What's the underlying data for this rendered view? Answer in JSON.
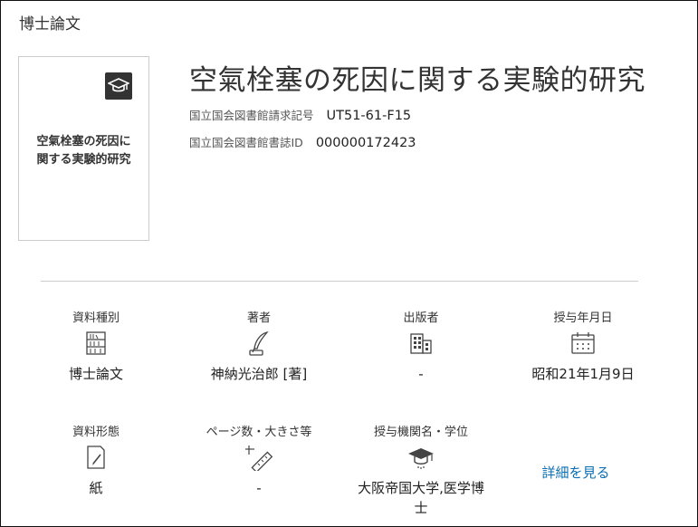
{
  "section_label": "博士論文",
  "thumbnail": {
    "icon": "graduation-cap-icon",
    "title_line1": "空氣栓塞の死因に",
    "title_line2": "関する実験的研究"
  },
  "title": "空氣栓塞の死因に関する実験的研究",
  "meta": {
    "call_number_label": "国立国会図書館請求記号",
    "call_number": "UT51-61-F15",
    "biblio_id_label": "国立国会図書館書誌ID",
    "biblio_id": "000000172423"
  },
  "details": {
    "material_type": {
      "label": "資料種別",
      "icon": "bookshelf-icon",
      "value": "博士論文"
    },
    "author": {
      "label": "著者",
      "icon": "quill-pen-icon",
      "value": "神納光治郎 [著]"
    },
    "publisher": {
      "label": "出版者",
      "icon": "building-icon",
      "value": "-"
    },
    "conferral_date": {
      "label": "授与年月日",
      "icon": "calendar-icon",
      "value": "昭和21年1月9日"
    },
    "material_form": {
      "label": "資料形態",
      "icon": "document-pen-icon",
      "value": "紙"
    },
    "pages_size": {
      "label": "ページ数・大きさ等",
      "icon": "ruler-icon",
      "value": "-"
    },
    "institution_degree": {
      "label": "授与機関名・学位",
      "icon": "graduation-cap-icon",
      "value_line1": "大阪帝国大学,医学博",
      "value_line2": "士"
    },
    "more_link": "詳細を見る"
  }
}
